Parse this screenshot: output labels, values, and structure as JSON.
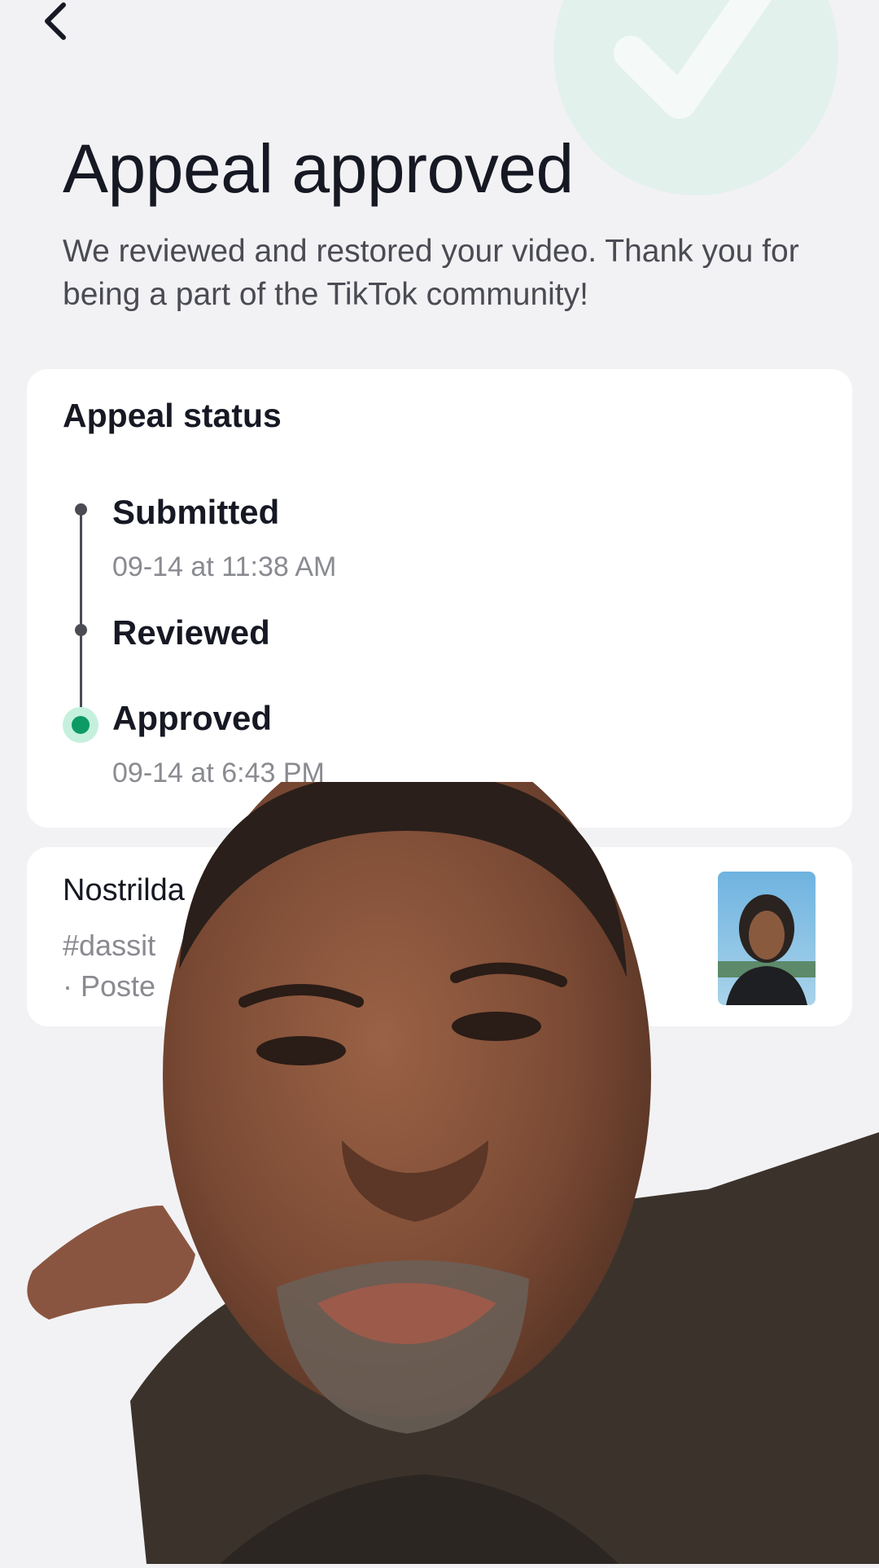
{
  "header": {
    "back_icon": "chevron-left-icon",
    "decor_icon": "checkmark-icon"
  },
  "page": {
    "title": "Appeal approved",
    "subtitle": "We reviewed and restored your video. Thank you for being a part of the TikTok community!"
  },
  "status_card": {
    "title": "Appeal status",
    "steps": [
      {
        "label": "Submitted",
        "time": "09-14 at 11:38 AM"
      },
      {
        "label": "Reviewed",
        "time": ""
      },
      {
        "label": "Approved",
        "time": "09-14 at 6:43 PM"
      }
    ]
  },
  "video_card": {
    "title": "Nostrilda",
    "tags": "#dassit",
    "posted": "· Poste"
  },
  "colors": {
    "accent_green": "#0d9a64",
    "accent_ring": "#c5f0de",
    "background": "#f2f2f4",
    "card": "#ffffff"
  }
}
